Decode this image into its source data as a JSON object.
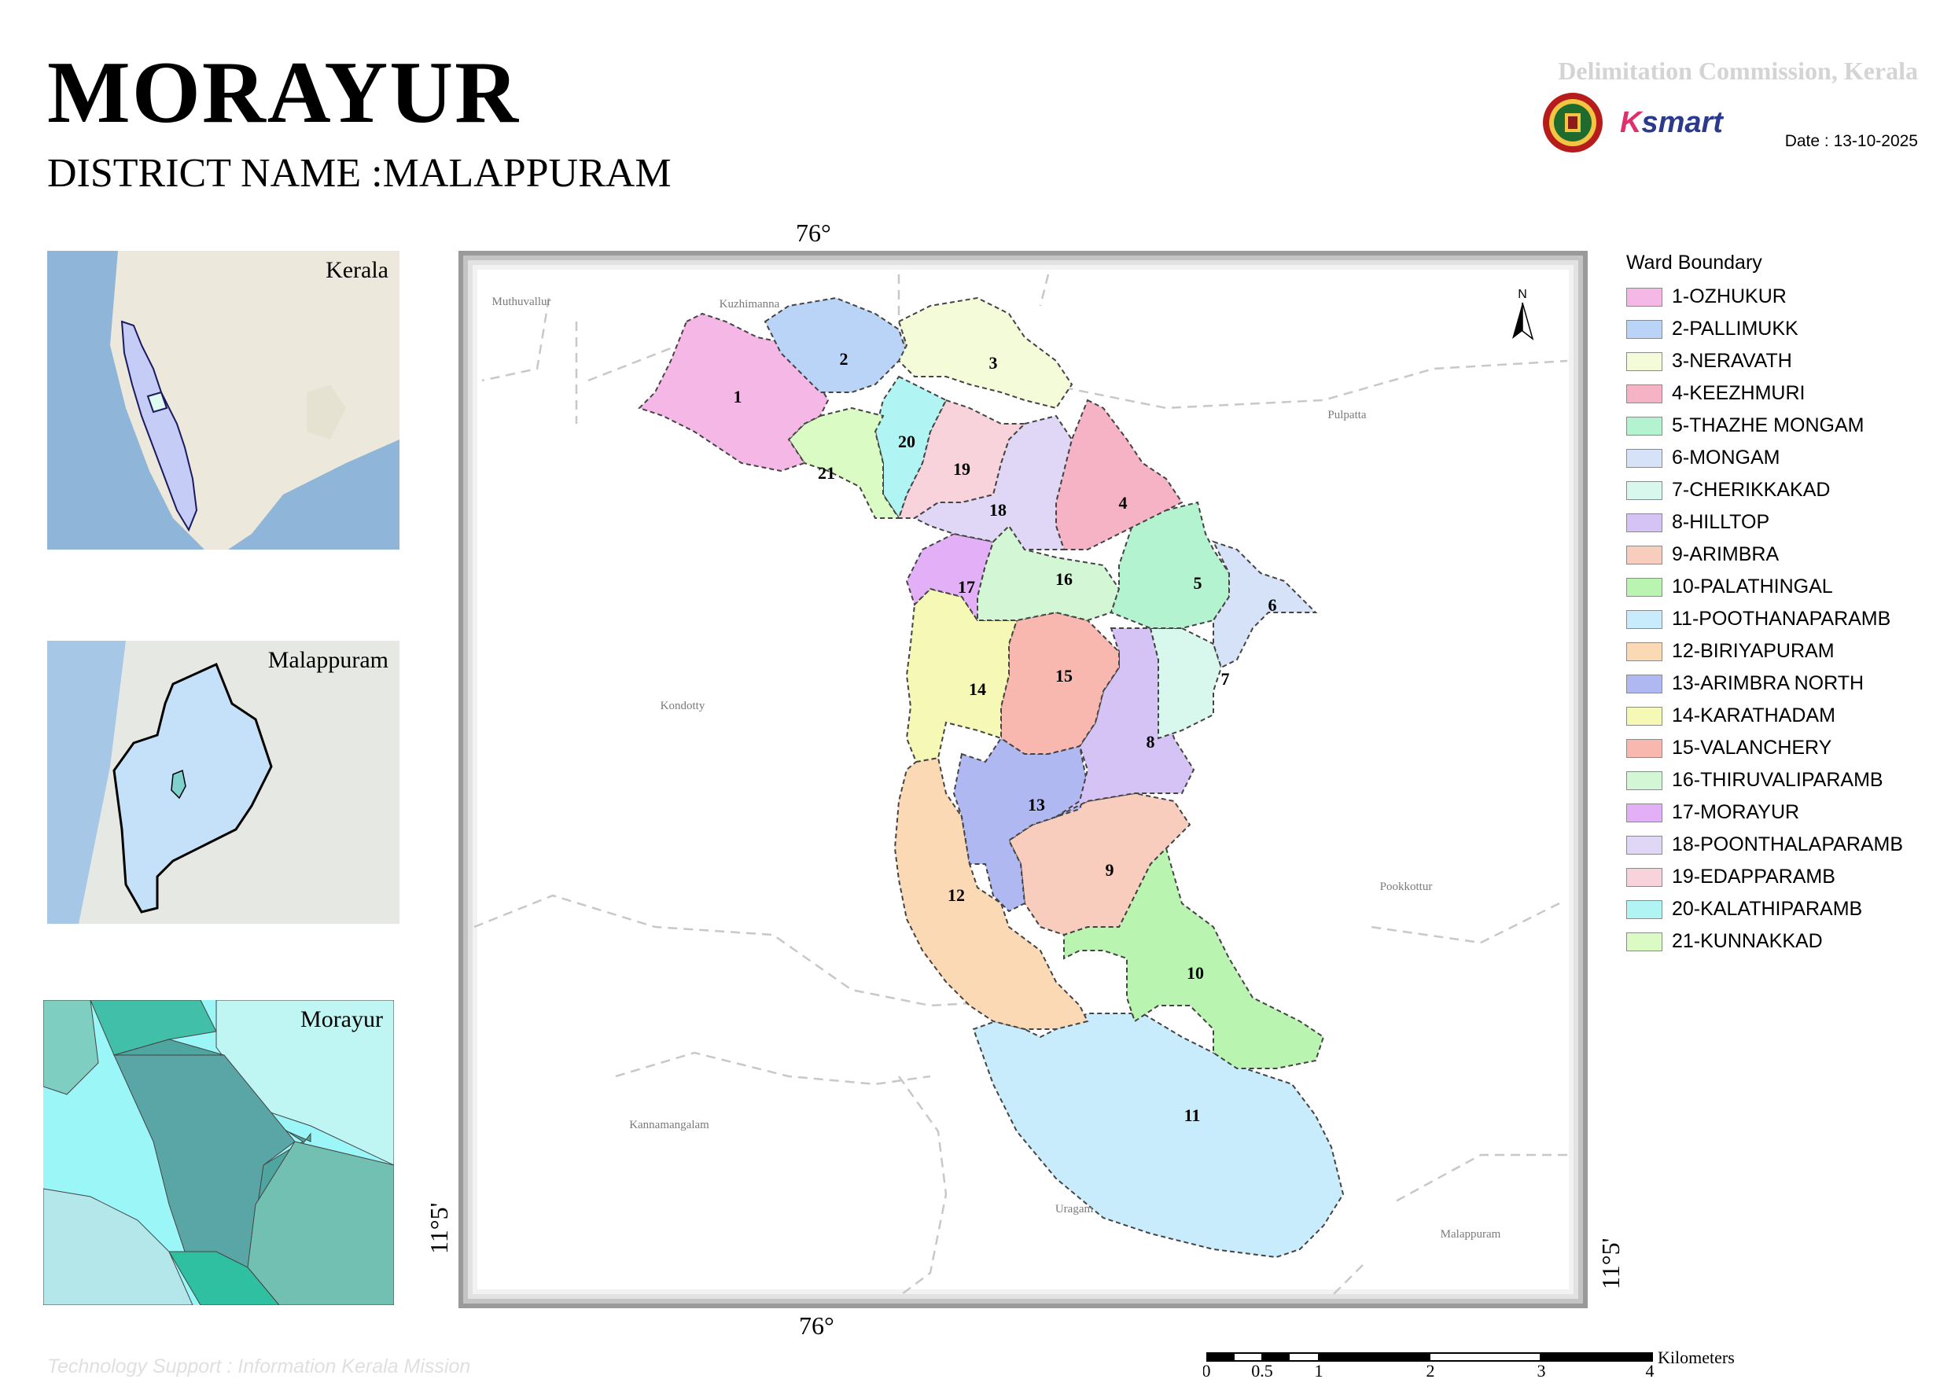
{
  "header": {
    "title": "MORAYUR",
    "district": "DISTRICT NAME :MALAPPURAM",
    "commission": "Delimitation Commission, Kerala",
    "date": "Date : 13-10-2025",
    "logo_text_k": "K",
    "logo_text_rest": "smart"
  },
  "insets": {
    "kerala": "Kerala",
    "malappuram": "Malappuram",
    "morayur": "Morayur"
  },
  "coords": {
    "lat_top": "76°",
    "lat_bottom": "76°",
    "lon_left": "11°5'",
    "lon_right": "11°5'"
  },
  "places": [
    "Muthuvallur",
    "Kuzhimanna",
    "Pulpatta",
    "Kondotty",
    "Pookkottur",
    "Kannamangalam",
    "Uragam",
    "Malappuram"
  ],
  "legend": {
    "title": "Ward Boundary",
    "items": [
      {
        "label": "1-OZHUKUR",
        "color": "#f5b8e6"
      },
      {
        "label": "2-PALLIMUKK",
        "color": "#b9d4f7"
      },
      {
        "label": "3-NERAVATH",
        "color": "#f3fbd8"
      },
      {
        "label": "4-KEEZHMURI",
        "color": "#f7b3c6"
      },
      {
        "label": "5-THAZHE MONGAM",
        "color": "#b3f3cf"
      },
      {
        "label": "6-MONGAM",
        "color": "#d6e2f8"
      },
      {
        "label": "7-CHERIKKAKAD",
        "color": "#d8f8ee"
      },
      {
        "label": "8-HILLTOP",
        "color": "#d6c3f5"
      },
      {
        "label": "9-ARIMBRA",
        "color": "#f9cdbd"
      },
      {
        "label": "10-PALATHINGAL",
        "color": "#b9f5b0"
      },
      {
        "label": "11-POOTHANAPARAMB",
        "color": "#c8ecfb"
      },
      {
        "label": "12-BIRIYAPURAM",
        "color": "#fcd9b5"
      },
      {
        "label": "13-ARIMBRA NORTH",
        "color": "#b0b8f2"
      },
      {
        "label": "14-KARATHADAM",
        "color": "#f6f8b5"
      },
      {
        "label": "15-VALANCHERY",
        "color": "#f8b8b0"
      },
      {
        "label": "16-THIRUVALIPARAMB",
        "color": "#d3f6d5"
      },
      {
        "label": "17-MORAYUR",
        "color": "#e3b0f7"
      },
      {
        "label": "18-POONTHALAPARAMB",
        "color": "#e0d6f6"
      },
      {
        "label": "19-EDAPPARAMB",
        "color": "#f8d3dc"
      },
      {
        "label": "20-KALATHIPARAMB",
        "color": "#b0f5f3"
      },
      {
        "label": "21-KUNNAKKAD",
        "color": "#dafbc3"
      }
    ]
  },
  "wards": [
    "1",
    "2",
    "3",
    "4",
    "5",
    "6",
    "7",
    "8",
    "9",
    "10",
    "11",
    "12",
    "13",
    "14",
    "15",
    "16",
    "17",
    "18",
    "19",
    "20",
    "21"
  ],
  "north": "N",
  "scale": {
    "unit": "Kilometers",
    "ticks": [
      "0",
      "0.5",
      "1",
      "2",
      "3",
      "4"
    ]
  },
  "credit": "Technology Support : Information Kerala Mission"
}
